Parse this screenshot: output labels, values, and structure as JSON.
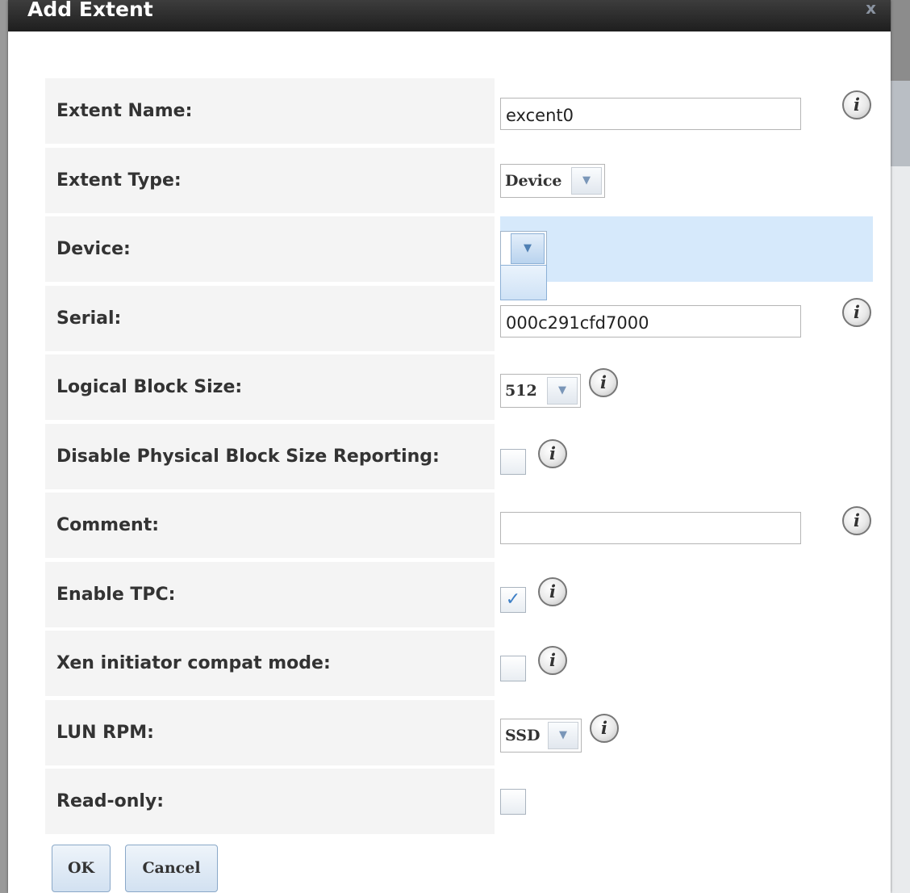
{
  "dialog": {
    "title": "Add Extent",
    "close_glyph": "x"
  },
  "fields": {
    "extent_name": {
      "label": "Extent Name:",
      "value": "excent0"
    },
    "extent_type": {
      "label": "Extent Type:",
      "value": "Device"
    },
    "device": {
      "label": "Device:",
      "value": ""
    },
    "serial": {
      "label": "Serial:",
      "value": "000c291cfd7000"
    },
    "logical_block_size": {
      "label": "Logical Block Size:",
      "value": "512"
    },
    "disable_pbs": {
      "label": "Disable Physical Block Size Reporting:",
      "checked": false
    },
    "comment": {
      "label": "Comment:",
      "value": ""
    },
    "enable_tpc": {
      "label": "Enable TPC:",
      "checked": true
    },
    "xen_compat": {
      "label": "Xen initiator compat mode:",
      "checked": false
    },
    "lun_rpm": {
      "label": "LUN RPM:",
      "value": "SSD"
    },
    "read_only": {
      "label": "Read-only:",
      "checked": false
    }
  },
  "icons": {
    "info": "i",
    "dropdown_arrow": "▼",
    "check": "✓"
  },
  "buttons": {
    "ok": "OK",
    "cancel": "Cancel"
  },
  "colors": {
    "titlebar": "#2a2a2a",
    "label_bg": "#f4f4f4",
    "highlight": "#d6e9fb",
    "button": "#d2e1f1"
  }
}
